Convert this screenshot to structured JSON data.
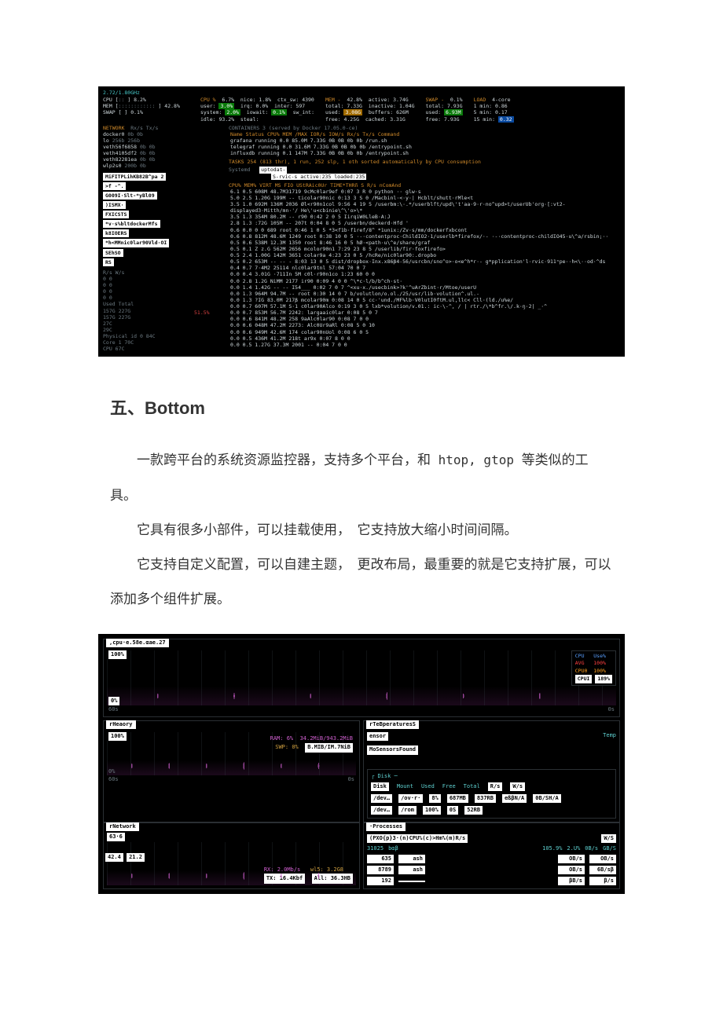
{
  "heading": "五、Bottom",
  "article": {
    "p1a": "一款跨平台的系统资源监控器，支持多个平台，和",
    "p1_mono": " htop, gtop ",
    "p1b": "等类似的工具。",
    "p2": "它具有很多小部件，可以挂载使用，　它支持放大缩小时间间隔。",
    "p3": "它支持自定义配置，可以自建主题，　更改布局，最重要的就是它支持扩展，可以添加多个组件扩展。"
  },
  "glances": {
    "cpu_freq": "2.72/1.80GHz",
    "top": {
      "cpu_pct": "6.7%",
      "user": "3.0%",
      "system": "2.0%",
      "idle": "93.2%",
      "nice": "1.8%",
      "irq": "0.0%",
      "iowait": "0.1%",
      "steal": "ctx_sw:",
      "ctx": "4390",
      "inter": "597",
      "mem_pct": "42.8%",
      "mem_total": "7.33G",
      "mem_used": "3.08G",
      "mem_free": "4.25G",
      "mem_active": "3.74G",
      "mem_inactive": "1.04G",
      "mem_buffers": "626M",
      "mem_cached": "3.31G",
      "swap_pct": "0.1%",
      "swap_total": "7.93G",
      "swap_used": "6.93M",
      "swap_free": "7.93G",
      "load_label": "LOAD",
      "cores": "4-core",
      "l1": "0.86",
      "l5": "0.17",
      "l15": "0.32",
      "left1": "8.2%",
      "left2": "42.8%",
      "left3": "0.1%"
    },
    "network": {
      "title": "NETWORK",
      "cols": "Rx/s    Tx/s",
      "ifaces": [
        {
          "n": "docker0",
          "rx": "0b",
          "tx": "0b"
        },
        {
          "n": "lo",
          "rx": "256b",
          "tx": "256b"
        },
        {
          "n": "veth56f6858",
          "rx": "0b",
          "tx": "0b"
        },
        {
          "n": "veth4105df2",
          "rx": "0b",
          "tx": "0b"
        },
        {
          "n": "veth82281ea",
          "rx": "0b",
          "tx": "0b"
        },
        {
          "n": "wlp2s0",
          "rx": "200b",
          "tx": "0b"
        }
      ]
    },
    "containers": {
      "title": "CONTAINERS 3 (served by Docker 17.05.0-ce)",
      "head": "Name        Status  CPU%   MEM   /MAX  IOR/s IOW/s  Rx/s  Tx/s Command",
      "rows": [
        "grafana    running  0.0  85.0M  7.33G   0B    0B    0b    0b /run.sh",
        "telegraf   running  0.0  31.6M  7.33G   0B    0B    0b    0b /entrypoint.sh",
        "influxdb   running  0.1   147M  7.33G   0B    0B    0b    0b /entrypoint.sh"
      ]
    },
    "tasks_line": "TASKS 254 (813 thr), 1 run, 252 slp, 1 oth sorted automatically by CPU consumption",
    "uptodate1": "uptodat-",
    "uptodate2": "S-rvic-s   active:235    loaded:235",
    "cols_head": "CPU%  MEM%  VIRT  MS    FIO UStRAic0Ur    TIME*THRñ    S  R/s  nComAnd",
    "left_boxes": [
      "MiFITPLihKB82B^pa 2",
      ">f              -^.",
      "G009I·Slt-*yBl09",
      ")ISMX·",
      "FXICSTS",
      "*v·s%bltdockerMfs",
      "k8IOERS",
      "*h<MMnic0lar90Vld·OI",
      "SEhSO",
      "RS"
    ],
    "left_meta": [
      "R/s      W/s",
      "0          0",
      "0          0",
      "0          0",
      "0          0",
      "Used   Total",
      "157G    227G",
      "157G    227G",
      "",
      "        27C",
      "        29C",
      "Physical id 0   84C",
      "Core 1          70C",
      "CPU             67C"
    ],
    "left_pct": "51.5%",
    "proc_rows": [
      "6.1   0.5  608M 48.7M31719  9cMc0lar9ef   0:07 3   R 0    python ·· glw·s",
      "5.0   2.5  1.20G 199M  --   ticolar90nic  0:13 3   S 0    /Macbinl·<·y·|  Hcblt/shutt·rMle<t",
      "3.5   1.0  692M 136M 2036   Øl<r90n1col   9:56 4  19 5    /userbm:\\·.*/userblft/upd\\'t'aa·9·r·no^upd>t/userUb'org·[:vt2-displayed3·Mitth/mn·'/ He\\'u<cbinie\\^\\'o>\\*",
      "3.5   1.3  354M 80.2M  --   r90           0:42 2   0 5    IirqiW0LleB·A:J",
      "2.8   1.3  :72G 105M  --    207t          0:04 8   0 5    /userbn/deckerd·Hfd '",
      "0.6   0.0  0     0    689   root          0:46 1   0 5    *3<f1b·f1ref/8^  *1unix:/Zv·s/mm/dockerfxbcont",
      "0.6   0.8  812M 48.6M 1249  root          0:38 10  0 5    ·-·contentproc·ChildIO2·1/userlb*firefox/·- ·-·contentproc-childIO45·u\\^a/rsbin;··",
      "0.5   0.6  538M 12.3M 1350  root          8:46 16  0 5    hØ·<path·u\\^e/share/graf",
      "0.5   0.1  Z z.G 562M 2656  mcolor90n1    7:29 23  8 5    /userlib/fir·foxfirefo>",
      "0.5   2.4  1.00G 142M 3651  colar9a       4:23 23  0 5    /hcRe/nic0lar90:.dropbo",
      "0.5   0.2  653M  --   --    -             8:03 13  0 5    dist/dropbox·Inx.x86β4-56/usrcbn/sno^o>·o<e^h*r·- g*pplication'l·rvic·911ⁿpe··h<\\··od·^ds",
      "0.4   0.7  7·4M2 25114 nlc0lar9tnl       57:04 70  0 7    ",
      "0.0   0.4  3.01G ·711In 5M  c0l·r90n1co   1:23 60  0 0    ",
      "0.0   2.8  1.2G NiMM 2177   ir90          0:09 4   0 0    ^\\*c·l/b/b^ch·st·",
      "0.0   1.4  1.42G --   --    I54___        0:02 7   0 7    ^<xu·x./usecbink>?k'^uArZbint·r/Mtoe/userU",
      "0.0   1.3  964M 94.7M  --   root          0:30 14  0 7    b/volutlon/o.ol./25/usr/lib·volution^.ul.-",
      "0.0   1.3  ?IG  83.0M 217β  mcolar90m     0:08 14  0 5    cc·'und./MF%lb·V0lutI0ftM.ul,llc< Cll·(ld./u%e/",
      "0.0   0.7  607M 57.1M S·1   c0lar90Alco   0:19 3   0 5    lxb*volution/v.01.: ic·\\-^, / | rtr./\\*b^fr.\\/.k·ŋ·2| _·^",
      "0.0   0.7  853M 56.7M 2242: largaaic0lar  0:08 5   0 7    ",
      "0.0   0.6  841M 48.2M 258   9aAlc0lar90   0:08 7   0 0    ",
      "0.0   0.6  048M 47.2M 2273: Alc0Ur9aRl    0:08 5   0 10   ",
      "0.0   0.6  949M 42.6M 174   colar90nUol   0:08 6   0 5    ",
      "0.0   0.5  436M 41.2M 218t  ar9x          0:07 8   0 0    ",
      "0.0   0.5  1.27G 37.3M 2001  --            0:04 7   0 0    "
    ]
  },
  "btm": {
    "cpu_title": ",cpu·e.58e.αae.27",
    "y100": "100%",
    "y0": "0%",
    "x60s": "60s",
    "x0s": "0s",
    "legend": {
      "cpu": "CPU",
      "use": "Use%",
      "avg": "AVG",
      "avg_v": "100%",
      "cpu0": "CPU0",
      "cpu0_v": "100%",
      "cpui": "CPUI",
      "cpui_v": "189%"
    },
    "mem": {
      "title": "rHeaory",
      "ram_lbl": "RAM:",
      "ram_pct": "6%",
      "ram_val": "34.2MiB/943.2MiB",
      "swp_lbl": "SWP:",
      "swp_pct": "0%",
      "swp_val": "B.MIB/IM.7NiB"
    },
    "temps": {
      "title": "rTeBperaturesS",
      "sensor": "ensor",
      "temp_lbl": "Temp",
      "msg": "MoSensorsFound"
    },
    "disk": {
      "title": "Disk",
      "head": [
        "Disk",
        "Mount",
        "Used",
        "Free",
        "Total",
        "R/s",
        "W/s"
      ],
      "rows": [
        [
          "/dev…",
          "/ov·r·",
          "8%",
          "687MB",
          "837RB",
          "eßβN/A",
          "0B/SH/A"
        ],
        [
          "/dev…",
          "/rom",
          "100%",
          "0S",
          "52RB",
          "",
          ""
        ]
      ]
    },
    "net": {
      "title": "rNetwork",
      "top_left": "63·6",
      "left1": "42.4",
      "left2": "21.2",
      "rx": "RX:  2.0Mb/s",
      "wlb": "wl5:  3.2G8",
      "tx": "TX:  16.4Kbf",
      "all": "All:   36.3HB"
    },
    "proc": {
      "title": "·Processes",
      "head_line": "(PXO{p}3·(n)CPU%(c)>Hm%(m)R/s",
      "w_lbl": "W/S",
      "rows": [
        {
          "pid": "31025",
          "name": "bαβ",
          "cpu": "105.9%",
          "mem": "2.U%",
          "r": "0B/s",
          "w": "GB/S"
        },
        {
          "pid": "635",
          "name": "ash",
          "cpu": "",
          "mem": "",
          "r": "OB/s",
          "w": "OB/s"
        },
        {
          "pid": "8789",
          "name": "ash",
          "cpu": "",
          "mem": "",
          "r": "OB/s",
          "w": "6B/sβ"
        },
        {
          "pid": "192",
          "name": "",
          "cpu": "",
          "mem": "",
          "r": "βB/s",
          "w": "β/s"
        }
      ]
    }
  }
}
